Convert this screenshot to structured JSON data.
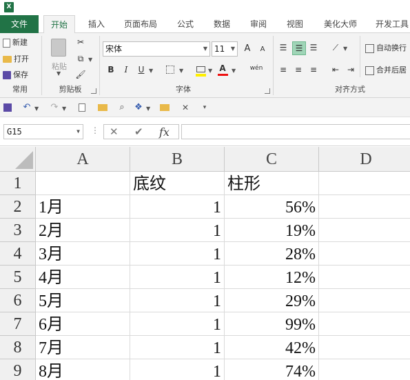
{
  "app": {
    "icon_letter": "X"
  },
  "tabs": [
    "文件",
    "开始",
    "插入",
    "页面布局",
    "公式",
    "数据",
    "审阅",
    "视图",
    "美化大师",
    "开发工具"
  ],
  "ribbon": {
    "clipboard": {
      "new": "新建",
      "open": "打开",
      "save": "保存",
      "group_label": "常用",
      "paste": "粘贴",
      "clip_label": "剪贴板"
    },
    "font": {
      "family": "宋体",
      "size": "11",
      "grow": "A",
      "shrink": "A",
      "bold": "B",
      "italic": "I",
      "underline": "U",
      "phonetic": "wén",
      "group_label": "字体"
    },
    "alignment": {
      "wrap": "自动换行",
      "merge": "合并后居",
      "group_label": "对齐方式"
    }
  },
  "name_box": "G15",
  "formula_bar": {
    "cancel": "✕",
    "enter": "✔",
    "fx": "fx",
    "value": ""
  },
  "columns": [
    "A",
    "B",
    "C",
    "D"
  ],
  "rows": [
    {
      "num": "1",
      "a": "",
      "b": "底纹",
      "c": "柱形"
    },
    {
      "num": "2",
      "a": "1月",
      "b": "1",
      "c": "56%"
    },
    {
      "num": "3",
      "a": "2月",
      "b": "1",
      "c": "19%"
    },
    {
      "num": "4",
      "a": "3月",
      "b": "1",
      "c": "28%"
    },
    {
      "num": "5",
      "a": "4月",
      "b": "1",
      "c": "12%"
    },
    {
      "num": "6",
      "a": "5月",
      "b": "1",
      "c": "29%"
    },
    {
      "num": "7",
      "a": "6月",
      "b": "1",
      "c": "99%"
    },
    {
      "num": "8",
      "a": "7月",
      "b": "1",
      "c": "42%"
    },
    {
      "num": "9",
      "a": "8月",
      "b": "1",
      "c": "74%"
    }
  ],
  "colors": {
    "accent": "#217346",
    "header_bg": "#f0f0f0",
    "align_active": "#9fd5b7"
  }
}
